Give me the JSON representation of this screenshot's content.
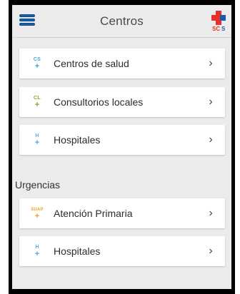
{
  "header": {
    "title": "Centros",
    "logo_text": "SCS"
  },
  "centros": [
    {
      "abbr": "CS",
      "color": "#3aa7c9",
      "label": "Centros de salud"
    },
    {
      "abbr": "CL",
      "color": "#7cab2a",
      "label": "Consultorios locales"
    },
    {
      "abbr": "H",
      "color": "#6aa1d8",
      "label": "Hospitales"
    }
  ],
  "urgencias": {
    "title": "Urgencias",
    "items": [
      {
        "abbr": "SUAP",
        "color": "#f0a020",
        "label": "Atención Primaria"
      },
      {
        "abbr": "H",
        "color": "#6aa1d8",
        "label": "Hospitales"
      }
    ]
  },
  "icons": {
    "menu": "hamburger-icon",
    "chevron": "chevron-right-icon",
    "cross": "plus-cross-icon"
  },
  "chevron_glyph": "›"
}
